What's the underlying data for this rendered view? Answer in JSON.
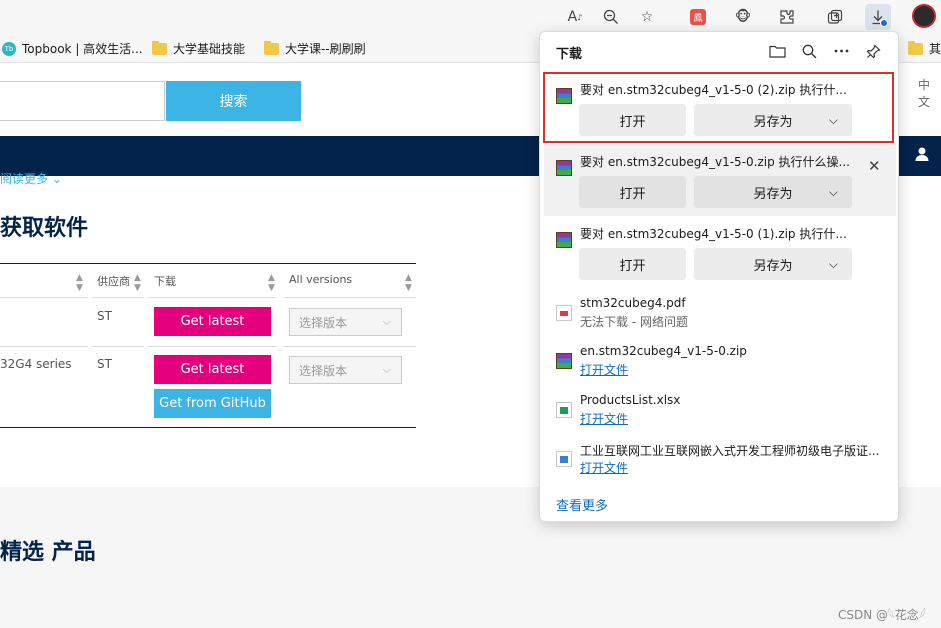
{
  "toolbar": {
    "icons": [
      "read-aloud-icon",
      "zoom-out-icon",
      "add-favorite-icon",
      "extension-red-icon",
      "monkey-extension-icon",
      "extensions-icon",
      "collections-icon",
      "downloads-icon",
      "profile-avatar"
    ],
    "red_badge_text": "鳳"
  },
  "favorites": {
    "items": [
      {
        "label": "Topbook | 高效生活...",
        "icon": "topbook-icon"
      },
      {
        "label": "大学基础技能",
        "icon": "folder-icon"
      },
      {
        "label": "大学课--刷刷刷",
        "icon": "folder-icon"
      }
    ],
    "overflow_label": "其"
  },
  "page": {
    "search_button": "搜索",
    "lang": "中文",
    "readmore": "阅读更多 ⌄",
    "section_title": "获取软件",
    "table": {
      "headers": [
        "供应商",
        "下载",
        "All versions"
      ],
      "rows": [
        {
          "name": "",
          "vendor": "ST",
          "get_latest": "Get latest",
          "select": "选择版本"
        },
        {
          "name": "32G4 series",
          "vendor": "ST",
          "get_latest": "Get latest",
          "github": "Get from GitHub",
          "select": "选择版本"
        }
      ]
    },
    "section_title2": "精选 产品",
    "watermark": "CSDN @𓆩花念𓆪"
  },
  "downloads": {
    "title": "下载",
    "header_icons": [
      "open-folder-icon",
      "search-icon",
      "more-icon",
      "pin-icon"
    ],
    "items": [
      {
        "name": "要对 en.stm32cubeg4_v1-5-0 (2).zip 执行什...",
        "type": "rar",
        "open": "打开",
        "save_as": "另存为"
      },
      {
        "name": "要对 en.stm32cubeg4_v1-5-0.zip 执行什么操...",
        "type": "rar",
        "open": "打开",
        "save_as": "另存为"
      },
      {
        "name": "要对 en.stm32cubeg4_v1-5-0 (1).zip 执行什...",
        "type": "rar",
        "open": "打开",
        "save_as": "另存为"
      },
      {
        "name": "stm32cubeg4.pdf",
        "type": "pdf",
        "sub": "无法下载 - 网络问题"
      },
      {
        "name": "en.stm32cubeg4_v1-5-0.zip",
        "type": "rar",
        "link": "打开文件"
      },
      {
        "name": "ProductsList.xlsx",
        "type": "xlsx",
        "link": "打开文件"
      },
      {
        "name": "工业互联网工业互联网嵌入式开发工程师初级电子版证...",
        "type": "doc",
        "link": "打开文件"
      }
    ],
    "see_more": "查看更多"
  }
}
